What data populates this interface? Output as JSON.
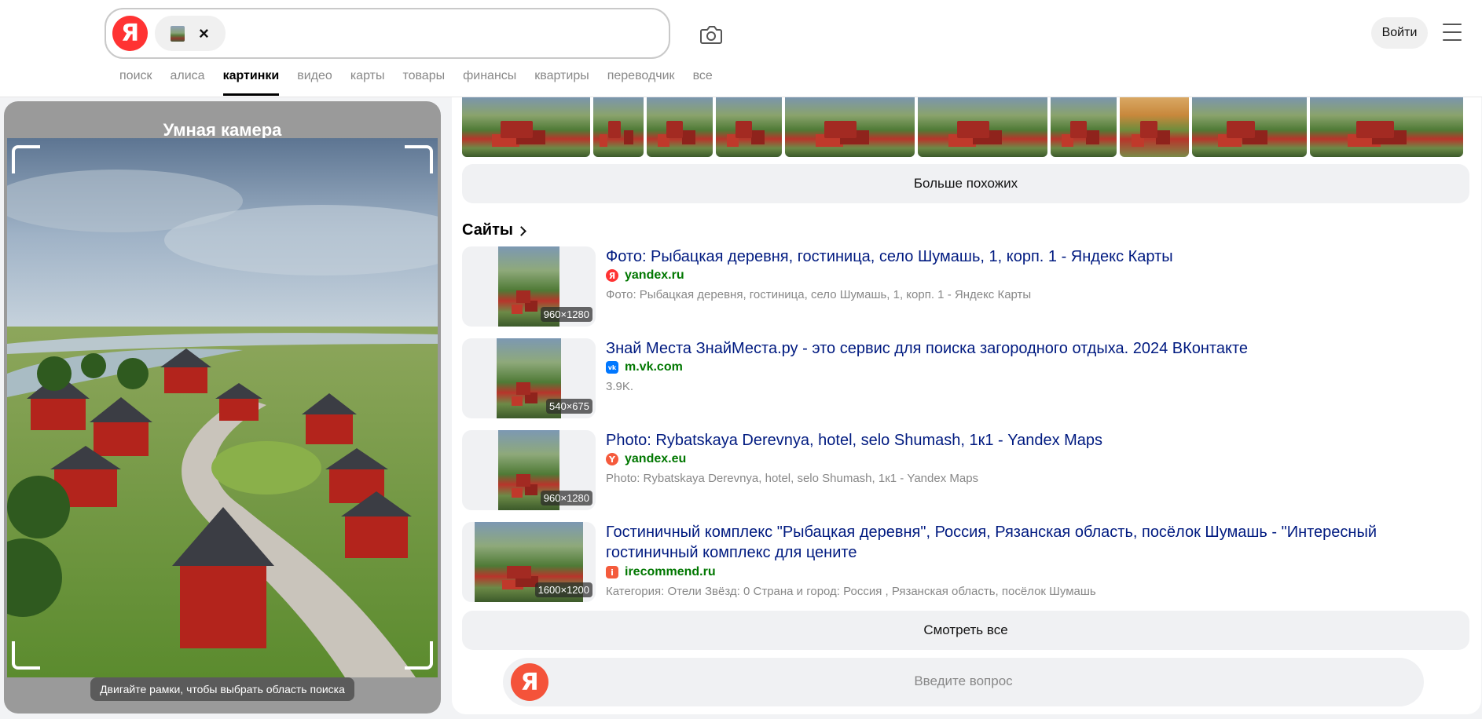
{
  "header": {
    "logo_letter": "Я",
    "login_label": "Войти",
    "tabs": [
      {
        "label": "поиск",
        "active": false
      },
      {
        "label": "алиса",
        "active": false
      },
      {
        "label": "картинки",
        "active": true
      },
      {
        "label": "видео",
        "active": false
      },
      {
        "label": "карты",
        "active": false
      },
      {
        "label": "товары",
        "active": false
      },
      {
        "label": "финансы",
        "active": false
      },
      {
        "label": "квартиры",
        "active": false
      },
      {
        "label": "переводчик",
        "active": false
      },
      {
        "label": "все",
        "active": false
      }
    ]
  },
  "camera": {
    "title": "Умная камера",
    "hint": "Двигайте рамки, чтобы выбрать область поиска"
  },
  "results": {
    "more_similar_label": "Больше похожих",
    "sites_heading": "Сайты",
    "sites": [
      {
        "title": "Фото: Рыбацкая деревня, гостиница, село Шумашь, 1, корп. 1 - Яндекс Карты",
        "favicon": "yandex-icon",
        "favicon_letter": "Я",
        "domain": "yandex.ru",
        "description": "Фото: Рыбацкая деревня, гостиница, село Шумашь, 1, корп. 1 - Яндекс Карты",
        "dimensions": "960×1280"
      },
      {
        "title": "Знай Места ЗнайМеста.ру - это сервис для поиска загородного отдыха. 2024 ВКонтакте",
        "favicon": "vk-icon",
        "favicon_letter": "vk",
        "domain": "m.vk.com",
        "description": "3.9K.",
        "dimensions": "540×675"
      },
      {
        "title": "Photo: Rybatskaya Derevnya, hotel, selo Shumash, 1к1 - Yandex Maps",
        "favicon": "yandex-eu-icon",
        "favicon_letter": "Y",
        "domain": "yandex.eu",
        "description": "Photo: Rybatskaya Derevnya, hotel, selo Shumash, 1к1 - Yandex Maps",
        "dimensions": "960×1280"
      },
      {
        "title": "Гостиничный комплекс \"Рыбацкая деревня\", Россия, Рязанская область, посёлок Шумашь - \"Интересный гостиничный комплекс для цените",
        "favicon": "irecommend-icon",
        "favicon_letter": "i",
        "domain": "irecommend.ru",
        "description": "Категория: Отели Звёзд: 0 Страна и город: Россия , Рязанская область, посёлок Шумашь",
        "dimensions": "1600×1200"
      }
    ],
    "see_all_label": "Смотреть все",
    "ask_placeholder": "Введите вопрос",
    "ask_logo_letter": "Я"
  }
}
